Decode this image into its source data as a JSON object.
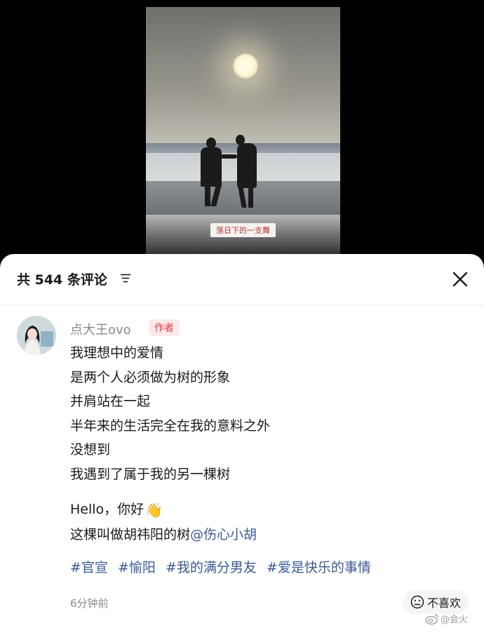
{
  "photo": {
    "caption": "落日下的一支舞"
  },
  "comments_sheet": {
    "title": "共 544 条评论",
    "comment": {
      "username": "点大王ovo",
      "badge": "作者",
      "lines": [
        "我理想中的爱情",
        "是两个人必须做为树的形象",
        "并肩站在一起",
        "半年来的生活完全在我的意料之外",
        "没想到",
        "我遇到了属于我的另一棵树"
      ],
      "hello_line": "Hello，你好",
      "tree_line_prefix": "这棵叫做胡祎阳的树",
      "mention": "@伤心小胡",
      "hashtags": [
        "#官宣",
        "#愉阳",
        "#我的满分男友",
        "#爱是快乐的事情"
      ],
      "time": "6分钟前",
      "dislike_label": "不喜欢"
    }
  },
  "watermark": {
    "text": "@会火"
  },
  "colors": {
    "link": "#3a5a94",
    "badge_text": "#e8394a",
    "badge_bg": "#fde9ea"
  }
}
